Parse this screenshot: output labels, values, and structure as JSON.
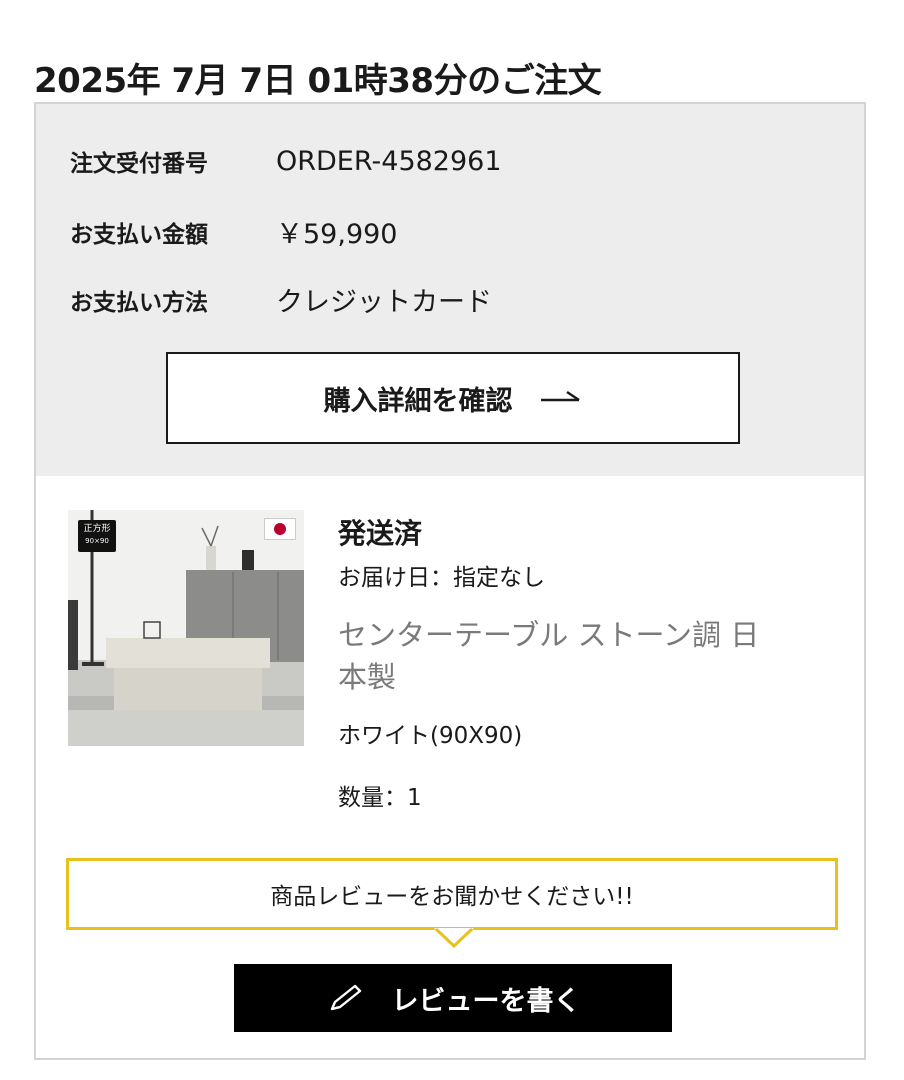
{
  "order": {
    "title": "2025年 7月 7日 01時38分のご注文",
    "fields": [
      {
        "label": "注文受付番号",
        "value": "ORDER-4582961"
      },
      {
        "label": "お支払い金額",
        "value": "￥59,990"
      },
      {
        "label": "お支払い方法",
        "value": "クレジットカード"
      }
    ],
    "details_button_label": "購入詳細を確認"
  },
  "item": {
    "image_badge": {
      "line1": "正方形",
      "line2": "90×90"
    },
    "status": "発送済",
    "delivery": "お届け日：指定なし",
    "name": "センターテーブル ストーン調 日本製",
    "variant": "ホワイト(90X90)",
    "quantity": "数量：1"
  },
  "review": {
    "prompt": "商品レビューをお聞かせください!!",
    "button_label": "レビューを書く"
  },
  "colors": {
    "summary_bg": "#ededed",
    "prompt_border": "#e8c11f",
    "button_bg": "#000000",
    "product_name": "#7a7a7a",
    "flag_red": "#bc002d"
  },
  "icons": {
    "details_arrow": "arrow-right-icon",
    "review_pen": "pen-icon",
    "flag": "japan-flag-icon"
  }
}
